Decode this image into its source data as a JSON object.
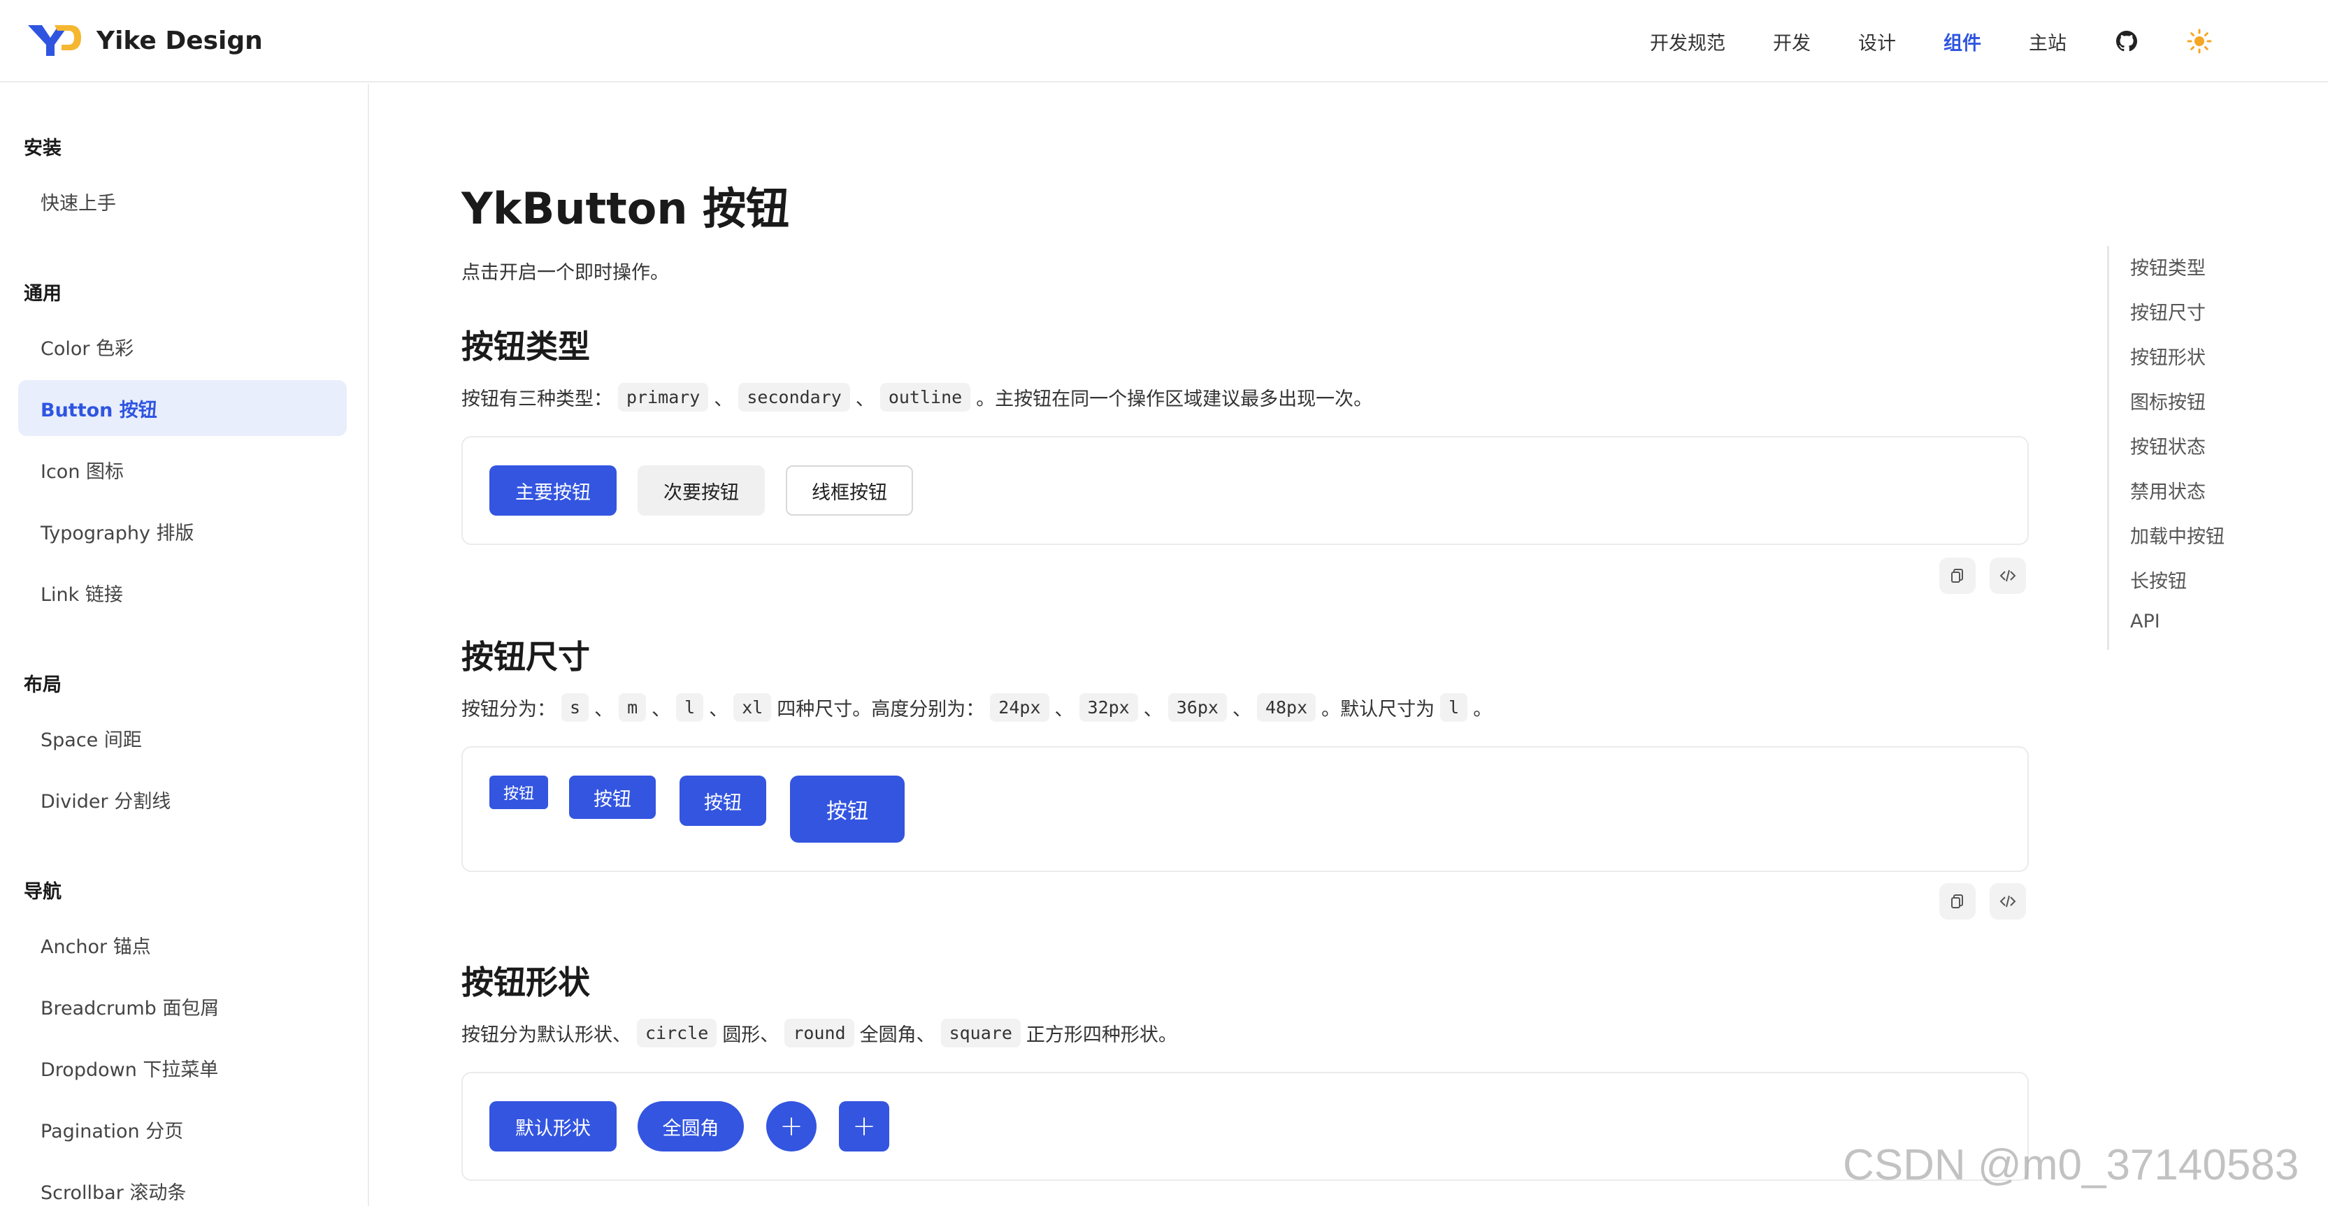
{
  "brand": {
    "name": "Yike Design"
  },
  "topnav": {
    "items": [
      "开发规范",
      "开发",
      "设计",
      "组件",
      "主站"
    ],
    "active_index": 3
  },
  "sidebar": {
    "groups": [
      {
        "title": "安装",
        "items": [
          "快速上手"
        ]
      },
      {
        "title": "通用",
        "items": [
          "Color 色彩",
          "Button 按钮",
          "Icon 图标",
          "Typography 排版",
          "Link 链接"
        ]
      },
      {
        "title": "布局",
        "items": [
          "Space 间距",
          "Divider 分割线"
        ]
      },
      {
        "title": "导航",
        "items": [
          "Anchor 锚点",
          "Breadcrumb 面包屑",
          "Dropdown 下拉菜单",
          "Pagination 分页",
          "Scrollbar 滚动条"
        ]
      }
    ],
    "active_item": "Button 按钮"
  },
  "main": {
    "title": "YkButton 按钮",
    "desc": "点击开启一个即时操作。",
    "sections": {
      "types": {
        "title": "按钮类型",
        "desc_prefix": "按钮有三种类型：",
        "codes": [
          "primary",
          "secondary",
          "outline"
        ],
        "sep": "、",
        "desc_suffix": "。主按钮在同一个操作区域建议最多出现一次。",
        "buttons": [
          "主要按钮",
          "次要按钮",
          "线框按钮"
        ]
      },
      "sizes": {
        "title": "按钮尺寸",
        "desc_prefix": "按钮分为：",
        "size_codes": [
          "s",
          "m",
          "l",
          "xl"
        ],
        "desc_mid": "四种尺寸。高度分别为：",
        "height_codes": [
          "24px",
          "32px",
          "36px",
          "48px"
        ],
        "desc_mid2": "。默认尺寸为",
        "default_code": "l",
        "desc_end": "。",
        "sep": "、",
        "button_label": "按钮"
      },
      "shapes": {
        "title": "按钮形状",
        "desc_1": "按钮分为默认形状、",
        "code_circle": "circle",
        "desc_2": "圆形、",
        "code_round": "round",
        "desc_3": "全圆角、",
        "code_square": "square",
        "desc_4": "正方形四种形状。",
        "buttons": [
          "默认形状",
          "全圆角"
        ],
        "plus_glyph": "+"
      }
    }
  },
  "anchor_nav": [
    "按钮类型",
    "按钮尺寸",
    "按钮形状",
    "图标按钮",
    "按钮状态",
    "禁用状态",
    "加载中按钮",
    "长按钮",
    "API"
  ],
  "watermark": "CSDN @m0_37140583",
  "colors": {
    "primary": "#3355e0",
    "active_text": "#2f55e0",
    "secondary_bg": "#f0f0f0"
  }
}
